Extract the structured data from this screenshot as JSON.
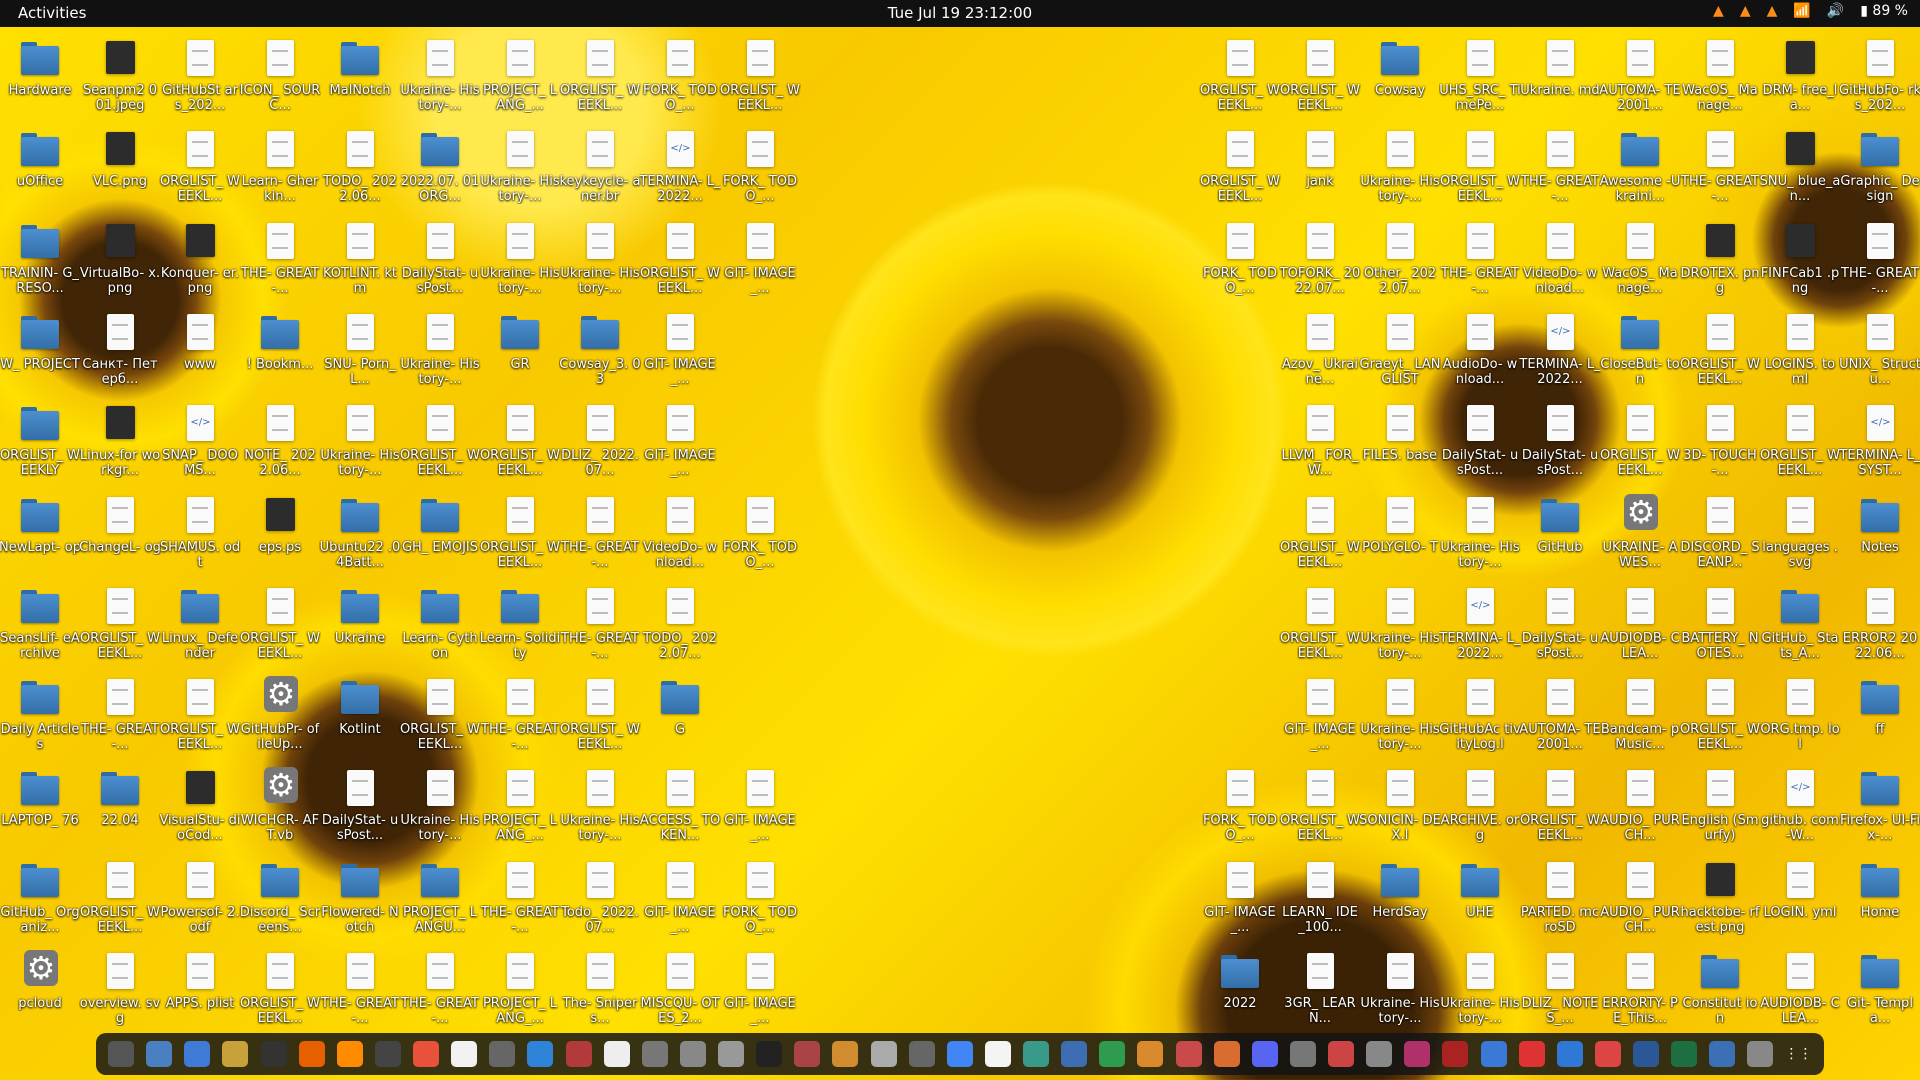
{
  "topbar": {
    "activities": "Activities",
    "clock": "Tue Jul 19  23:12:00",
    "battery": "89 %"
  },
  "desktop": {
    "left": [
      [
        {
          "label": "Hardware",
          "kind": "folder"
        },
        {
          "label": "Seanpm2 001.jpeg",
          "kind": "pic"
        },
        {
          "label": "GitHubSt ars_202...",
          "kind": "doc"
        },
        {
          "label": "ICON_ SOURC...",
          "kind": "doc"
        },
        {
          "label": "MalNotch",
          "kind": "folder"
        },
        {
          "label": "Ukraine- History-...",
          "kind": "doc"
        },
        {
          "label": "PROJECT_ LANG_...",
          "kind": "doc"
        },
        {
          "label": "ORGLIST_ WEEKL...",
          "kind": "doc"
        },
        {
          "label": "FORK_ TODO_...",
          "kind": "doc"
        },
        {
          "label": "ORGLIST_ WEEKL...",
          "kind": "doc"
        }
      ],
      [
        {
          "label": "uOffice",
          "kind": "folder"
        },
        {
          "label": "VLC.png",
          "kind": "pic"
        },
        {
          "label": "ORGLIST_ WEEKL...",
          "kind": "doc"
        },
        {
          "label": "Learn- Gherkin...",
          "kind": "doc"
        },
        {
          "label": "TODO_ 2022.06...",
          "kind": "doc"
        },
        {
          "label": "2022.07. 01ORG...",
          "kind": "folder"
        },
        {
          "label": "Ukraine- History-...",
          "kind": "doc"
        },
        {
          "label": "keykeycle- aner.br",
          "kind": "doc"
        },
        {
          "label": "TERMINA- L_2022...",
          "kind": "code"
        },
        {
          "label": "FORK_ TODO_...",
          "kind": "doc"
        }
      ],
      [
        {
          "label": "TRAININ- G_RESO...",
          "kind": "folder"
        },
        {
          "label": "VirtualBo- x.png",
          "kind": "pic"
        },
        {
          "label": "Konquer- er.png",
          "kind": "pic"
        },
        {
          "label": "THE- GREAT-...",
          "kind": "doc"
        },
        {
          "label": "KOTLINT. ktm",
          "kind": "doc"
        },
        {
          "label": "DailyStat- usPost...",
          "kind": "doc"
        },
        {
          "label": "Ukraine- History-...",
          "kind": "doc"
        },
        {
          "label": "Ukraine- History-...",
          "kind": "doc"
        },
        {
          "label": "ORGLIST_ WEEKL...",
          "kind": "doc"
        },
        {
          "label": "GIT- IMAGE_...",
          "kind": "doc"
        }
      ],
      [
        {
          "label": "W_ PROJECT",
          "kind": "folder"
        },
        {
          "label": "Санкт- Петерб...",
          "kind": "doc"
        },
        {
          "label": "www",
          "kind": "doc"
        },
        {
          "label": "! Bookm...",
          "kind": "folder"
        },
        {
          "label": "SNU- Porn_L...",
          "kind": "doc"
        },
        {
          "label": "Ukraine- History-...",
          "kind": "doc"
        },
        {
          "label": "GR",
          "kind": "folder"
        },
        {
          "label": "Cowsay_3. 03",
          "kind": "folder"
        },
        {
          "label": "GIT- IMAGE_...",
          "kind": "doc"
        },
        {
          "label": "",
          "kind": "none"
        }
      ],
      [
        {
          "label": "ORGLIST_ WEEKLY",
          "kind": "folder"
        },
        {
          "label": "Linux-for workgr...",
          "kind": "pic"
        },
        {
          "label": "SNAP_ DOOMS...",
          "kind": "code"
        },
        {
          "label": "NOTE_ 2022.06...",
          "kind": "doc"
        },
        {
          "label": "Ukraine- History-...",
          "kind": "doc"
        },
        {
          "label": "ORGLIST_ WEEKL...",
          "kind": "doc"
        },
        {
          "label": "ORGLIST_ WEEKL...",
          "kind": "doc"
        },
        {
          "label": "DLIZ_ 2022.07...",
          "kind": "doc"
        },
        {
          "label": "GIT- IMAGE_...",
          "kind": "doc"
        },
        {
          "label": "",
          "kind": "none"
        }
      ],
      [
        {
          "label": "NewLapt- op",
          "kind": "folder"
        },
        {
          "label": "ChangeL- og",
          "kind": "doc"
        },
        {
          "label": "SHAMUS. odt",
          "kind": "doc"
        },
        {
          "label": "eps.ps",
          "kind": "pic"
        },
        {
          "label": "Ubuntu22 .04Batt...",
          "kind": "folder"
        },
        {
          "label": "GH_ EMOJIS",
          "kind": "folder"
        },
        {
          "label": "ORGLIST_ WEEKL...",
          "kind": "doc"
        },
        {
          "label": "THE- GREAT-...",
          "kind": "doc"
        },
        {
          "label": "VideoDo- wnload...",
          "kind": "doc"
        },
        {
          "label": "FORK_ TODO_...",
          "kind": "doc"
        }
      ],
      [
        {
          "label": "SeansLif- eArchive",
          "kind": "folder"
        },
        {
          "label": "ORGLIST_ WEEKL...",
          "kind": "doc"
        },
        {
          "label": "Linux_ Defender",
          "kind": "folder"
        },
        {
          "label": "ORGLIST_ WEEKL...",
          "kind": "doc"
        },
        {
          "label": "Ukraine",
          "kind": "folder"
        },
        {
          "label": "Learn- Cython",
          "kind": "folder"
        },
        {
          "label": "Learn- Solidity",
          "kind": "folder"
        },
        {
          "label": "THE- GREAT-...",
          "kind": "doc"
        },
        {
          "label": "TODO_ 2022.07...",
          "kind": "doc"
        },
        {
          "label": "",
          "kind": "none"
        }
      ],
      [
        {
          "label": "Daily Articles",
          "kind": "folder"
        },
        {
          "label": "THE- GREAT-...",
          "kind": "doc"
        },
        {
          "label": "ORGLIST_ WEEKL...",
          "kind": "doc"
        },
        {
          "label": "GitHubPr- ofileUp...",
          "kind": "gear"
        },
        {
          "label": "Kotlint",
          "kind": "folder"
        },
        {
          "label": "ORGLIST_ WEEKL...",
          "kind": "doc"
        },
        {
          "label": "THE- GREAT-...",
          "kind": "doc"
        },
        {
          "label": "ORGLIST_ WEEKL...",
          "kind": "doc"
        },
        {
          "label": "G",
          "kind": "folder"
        },
        {
          "label": "",
          "kind": "none"
        }
      ],
      [
        {
          "label": "LAPTOP_ 76",
          "kind": "folder"
        },
        {
          "label": "22.04",
          "kind": "folder"
        },
        {
          "label": "VisualStu- dioCod...",
          "kind": "pic"
        },
        {
          "label": "WICHCR- AFT.vb",
          "kind": "gear"
        },
        {
          "label": "DailyStat- usPost...",
          "kind": "doc"
        },
        {
          "label": "Ukraine- History-...",
          "kind": "doc"
        },
        {
          "label": "PROJECT_ LANG_...",
          "kind": "doc"
        },
        {
          "label": "Ukraine- History-...",
          "kind": "doc"
        },
        {
          "label": "ACCESS_ TOKEN...",
          "kind": "doc"
        },
        {
          "label": "GIT- IMAGE_...",
          "kind": "doc"
        }
      ],
      [
        {
          "label": "GitHub_ Organiz...",
          "kind": "folder"
        },
        {
          "label": "ORGLIST_ WEEKL...",
          "kind": "doc"
        },
        {
          "label": "Powersof- 2.odf",
          "kind": "doc"
        },
        {
          "label": "Discord_ Screens...",
          "kind": "folder"
        },
        {
          "label": "Flowered- Notch",
          "kind": "folder"
        },
        {
          "label": "PROJECT_ LANGU...",
          "kind": "folder"
        },
        {
          "label": "THE- GREAT-...",
          "kind": "doc"
        },
        {
          "label": "Todo_ 2022.07...",
          "kind": "doc"
        },
        {
          "label": "GIT- IMAGE_...",
          "kind": "doc"
        },
        {
          "label": "FORK_ TODO_...",
          "kind": "doc"
        }
      ],
      [
        {
          "label": "pcloud",
          "kind": "gear"
        },
        {
          "label": "overview. svg",
          "kind": "doc"
        },
        {
          "label": "APPS. plist",
          "kind": "doc"
        },
        {
          "label": "ORGLIST_ WEEKL...",
          "kind": "doc"
        },
        {
          "label": "THE- GREAT-...",
          "kind": "doc"
        },
        {
          "label": "THE- GREAT-...",
          "kind": "doc"
        },
        {
          "label": "PROJECT_ LANG_...",
          "kind": "doc"
        },
        {
          "label": "The- Snipers...",
          "kind": "doc"
        },
        {
          "label": "MISCQU- OTES_2...",
          "kind": "doc"
        },
        {
          "label": "GIT- IMAGE_...",
          "kind": "doc"
        }
      ]
    ],
    "right": [
      [
        {
          "label": "ORGLIST_ WEEKL...",
          "kind": "doc"
        },
        {
          "label": "ORGLIST_ WEEKL...",
          "kind": "doc"
        },
        {
          "label": "Cowsay",
          "kind": "folder"
        },
        {
          "label": "UHS_SRC_ TimePe...",
          "kind": "doc"
        },
        {
          "label": "Ukraine. md",
          "kind": "doc"
        },
        {
          "label": "AUTOMA- TE2001...",
          "kind": "doc"
        },
        {
          "label": "WacOS_ Manage...",
          "kind": "doc"
        },
        {
          "label": "DRM- free_la...",
          "kind": "pic"
        },
        {
          "label": "GitHubFo- rks_202...",
          "kind": "doc"
        }
      ],
      [
        {
          "label": "ORGLIST_ WEEKL...",
          "kind": "doc"
        },
        {
          "label": "jank",
          "kind": "doc"
        },
        {
          "label": "Ukraine- History-...",
          "kind": "doc"
        },
        {
          "label": "ORGLIST_ WEEKL...",
          "kind": "doc"
        },
        {
          "label": "THE- GREAT-...",
          "kind": "doc"
        },
        {
          "label": "Awesome -Ukraini...",
          "kind": "folder"
        },
        {
          "label": "THE- GREAT-...",
          "kind": "doc"
        },
        {
          "label": "SNU_ blue_an...",
          "kind": "pic"
        },
        {
          "label": "Graphic_ Design",
          "kind": "folder"
        }
      ],
      [
        {
          "label": "FORK_ TODO_...",
          "kind": "doc"
        },
        {
          "label": "TOFORK_ 2022.07...",
          "kind": "doc"
        },
        {
          "label": "Other_ 2022.07...",
          "kind": "doc"
        },
        {
          "label": "THE- GREAT-...",
          "kind": "doc"
        },
        {
          "label": "VideoDo- wnload...",
          "kind": "doc"
        },
        {
          "label": "WacOS_ Manage...",
          "kind": "doc"
        },
        {
          "label": "DROTEX. png",
          "kind": "pic"
        },
        {
          "label": "FINFCab1 .png",
          "kind": "pic"
        },
        {
          "label": "THE- GREAT-...",
          "kind": "doc"
        }
      ],
      [
        {
          "label": "",
          "kind": "none"
        },
        {
          "label": "Azov_ Ukraine...",
          "kind": "doc"
        },
        {
          "label": "Graeyt_ LANGLIST",
          "kind": "doc"
        },
        {
          "label": "AudioDo- wnload...",
          "kind": "doc"
        },
        {
          "label": "TERMINA- L_2022...",
          "kind": "code"
        },
        {
          "label": "CloseBut- ton",
          "kind": "folder"
        },
        {
          "label": "ORGLIST_ WEEKL...",
          "kind": "doc"
        },
        {
          "label": "LOGINS. toml",
          "kind": "doc"
        },
        {
          "label": "UNIX_ Structu...",
          "kind": "doc"
        }
      ],
      [
        {
          "label": "",
          "kind": "none"
        },
        {
          "label": "LLVM_ FOR_W...",
          "kind": "doc"
        },
        {
          "label": "FILES. base",
          "kind": "doc"
        },
        {
          "label": "DailyStat- usPost...",
          "kind": "doc"
        },
        {
          "label": "DailyStat- usPost...",
          "kind": "doc"
        },
        {
          "label": "ORGLIST_ WEEKL...",
          "kind": "doc"
        },
        {
          "label": "3D- TOUCH-...",
          "kind": "doc"
        },
        {
          "label": "ORGLIST_ WEEKL...",
          "kind": "doc"
        },
        {
          "label": "TERMINA- L_SYST...",
          "kind": "code"
        }
      ],
      [
        {
          "label": "",
          "kind": "none"
        },
        {
          "label": "ORGLIST_ WEEKL...",
          "kind": "doc"
        },
        {
          "label": "POLYGLO- T",
          "kind": "doc"
        },
        {
          "label": "Ukraine- History-...",
          "kind": "doc"
        },
        {
          "label": "GitHub",
          "kind": "folder"
        },
        {
          "label": "UKRAINE- AWES...",
          "kind": "gear"
        },
        {
          "label": "DISCORD_ SEANP...",
          "kind": "doc"
        },
        {
          "label": "languages .svg",
          "kind": "doc"
        },
        {
          "label": "Notes",
          "kind": "folder"
        }
      ],
      [
        {
          "label": "",
          "kind": "none"
        },
        {
          "label": "ORGLIST_ WEEKL...",
          "kind": "doc"
        },
        {
          "label": "Ukraine- History-...",
          "kind": "doc"
        },
        {
          "label": "TERMINA- L_2022...",
          "kind": "code"
        },
        {
          "label": "DailyStat- usPost...",
          "kind": "doc"
        },
        {
          "label": "AUDIODB- CLEA...",
          "kind": "doc"
        },
        {
          "label": "BATTERY_ NOTES...",
          "kind": "doc"
        },
        {
          "label": "GitHub_ Stats_A...",
          "kind": "folder"
        },
        {
          "label": "ERROR2 2022.06...",
          "kind": "doc"
        }
      ],
      [
        {
          "label": "",
          "kind": "none"
        },
        {
          "label": "GIT- IMAGE_...",
          "kind": "doc"
        },
        {
          "label": "Ukraine- History-...",
          "kind": "doc"
        },
        {
          "label": "GitHubAc tivityLog.l",
          "kind": "doc"
        },
        {
          "label": "AUTOMA- TE2001...",
          "kind": "doc"
        },
        {
          "label": "Bandcam- pMusic...",
          "kind": "doc"
        },
        {
          "label": "ORGLIST_ WEEKL...",
          "kind": "doc"
        },
        {
          "label": "ORG.tmp. lol",
          "kind": "doc"
        },
        {
          "label": "ff",
          "kind": "folder"
        }
      ],
      [
        {
          "label": "FORK_ TODO_...",
          "kind": "doc"
        },
        {
          "label": "ORGLIST_ WEEKL...",
          "kind": "doc"
        },
        {
          "label": "SONICIN- DEX.l",
          "kind": "doc"
        },
        {
          "label": "ARCHIVE. org",
          "kind": "doc"
        },
        {
          "label": "ORGLIST_ WEEKL...",
          "kind": "doc"
        },
        {
          "label": "AUDIO_ PURCH...",
          "kind": "doc"
        },
        {
          "label": "English (Smurfy)",
          "kind": "doc"
        },
        {
          "label": "github. com-W...",
          "kind": "code"
        },
        {
          "label": "Firefox- UI-Fix-...",
          "kind": "folder"
        }
      ],
      [
        {
          "label": "GIT- IMAGE_...",
          "kind": "doc"
        },
        {
          "label": "LEARN_ IDE_100...",
          "kind": "doc"
        },
        {
          "label": "HerdSay",
          "kind": "folder"
        },
        {
          "label": "UHE",
          "kind": "folder"
        },
        {
          "label": "PARTED. mcroSD",
          "kind": "doc"
        },
        {
          "label": "AUDIO_ PURCH...",
          "kind": "doc"
        },
        {
          "label": "hacktobe- rfest.png",
          "kind": "pic"
        },
        {
          "label": "LOGIN. yml",
          "kind": "doc"
        },
        {
          "label": "Home",
          "kind": "folder"
        }
      ],
      [
        {
          "label": "2022",
          "kind": "folder"
        },
        {
          "label": "3GR_ LEARN...",
          "kind": "doc"
        },
        {
          "label": "Ukraine- History-...",
          "kind": "doc"
        },
        {
          "label": "Ukraine- History-...",
          "kind": "doc"
        },
        {
          "label": "DLIZ_ NOTES_...",
          "kind": "doc"
        },
        {
          "label": "ERRORTY- PE_This...",
          "kind": "doc"
        },
        {
          "label": "Constitut ion",
          "kind": "folder"
        },
        {
          "label": "AUDIODB- CLEA...",
          "kind": "doc"
        },
        {
          "label": "Git- Templa...",
          "kind": "folder"
        }
      ]
    ]
  },
  "dock": {
    "items": [
      "terminal",
      "files",
      "text-editor",
      "office",
      "terminal-2",
      "firefox",
      "vlc",
      "obs",
      "software",
      "notes",
      "calculator",
      "help",
      "monitor",
      "document",
      "settings",
      "3d",
      "circle",
      "inkscape",
      "gimp",
      "game",
      "archive",
      "search",
      "chrome",
      "paint",
      "screenshot",
      "camera",
      "spreadsheet",
      "pack",
      "calendar",
      "presentation",
      "discord",
      "disk",
      "image",
      "percent",
      "media",
      "vm",
      "dropbox",
      "store",
      "vscode",
      "heart",
      "word",
      "table",
      "code",
      "trash",
      "apps-grid"
    ]
  }
}
